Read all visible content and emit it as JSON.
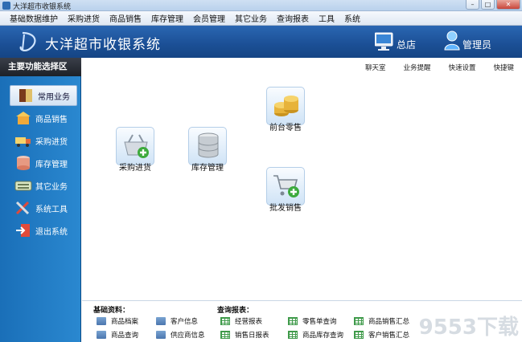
{
  "window": {
    "title": "大洋超市收银系统"
  },
  "menu": [
    "基础数据维护",
    "采购进货",
    "商品销售",
    "库存管理",
    "会员管理",
    "其它业务",
    "查询报表",
    "工具",
    "系统"
  ],
  "banner": {
    "app_name": "大洋超市收银系统",
    "store_label": "总店",
    "user_label": "管理员"
  },
  "sidebar": {
    "header": "主要功能选择区",
    "items": [
      {
        "label": "常用业务",
        "icon": "book-icon",
        "active": true
      },
      {
        "label": "商品销售",
        "icon": "shop-icon"
      },
      {
        "label": "采购进货",
        "icon": "truck-icon"
      },
      {
        "label": "库存管理",
        "icon": "database-icon"
      },
      {
        "label": "其它业务",
        "icon": "keyboard-icon"
      },
      {
        "label": "系统工具",
        "icon": "tools-icon"
      },
      {
        "label": "退出系统",
        "icon": "exit-icon"
      }
    ]
  },
  "toolbar": [
    "聊天室",
    "业务提醒",
    "快速设置",
    "快捷键"
  ],
  "tiles": {
    "retail": "前台零售",
    "purchase": "采购进货",
    "stock": "库存管理",
    "wholesale": "批发销售"
  },
  "bottom": {
    "basic_title": "基础资料：",
    "query_title": "查询报表：",
    "basic": [
      "商品档案",
      "客户信息",
      "商品查询",
      "供应商信息"
    ],
    "query": [
      "经营报表",
      "零售单查询",
      "商品销售汇总",
      "销售日报表",
      "商品库存查询",
      "客户销售汇总"
    ]
  },
  "watermark": "9553下载"
}
